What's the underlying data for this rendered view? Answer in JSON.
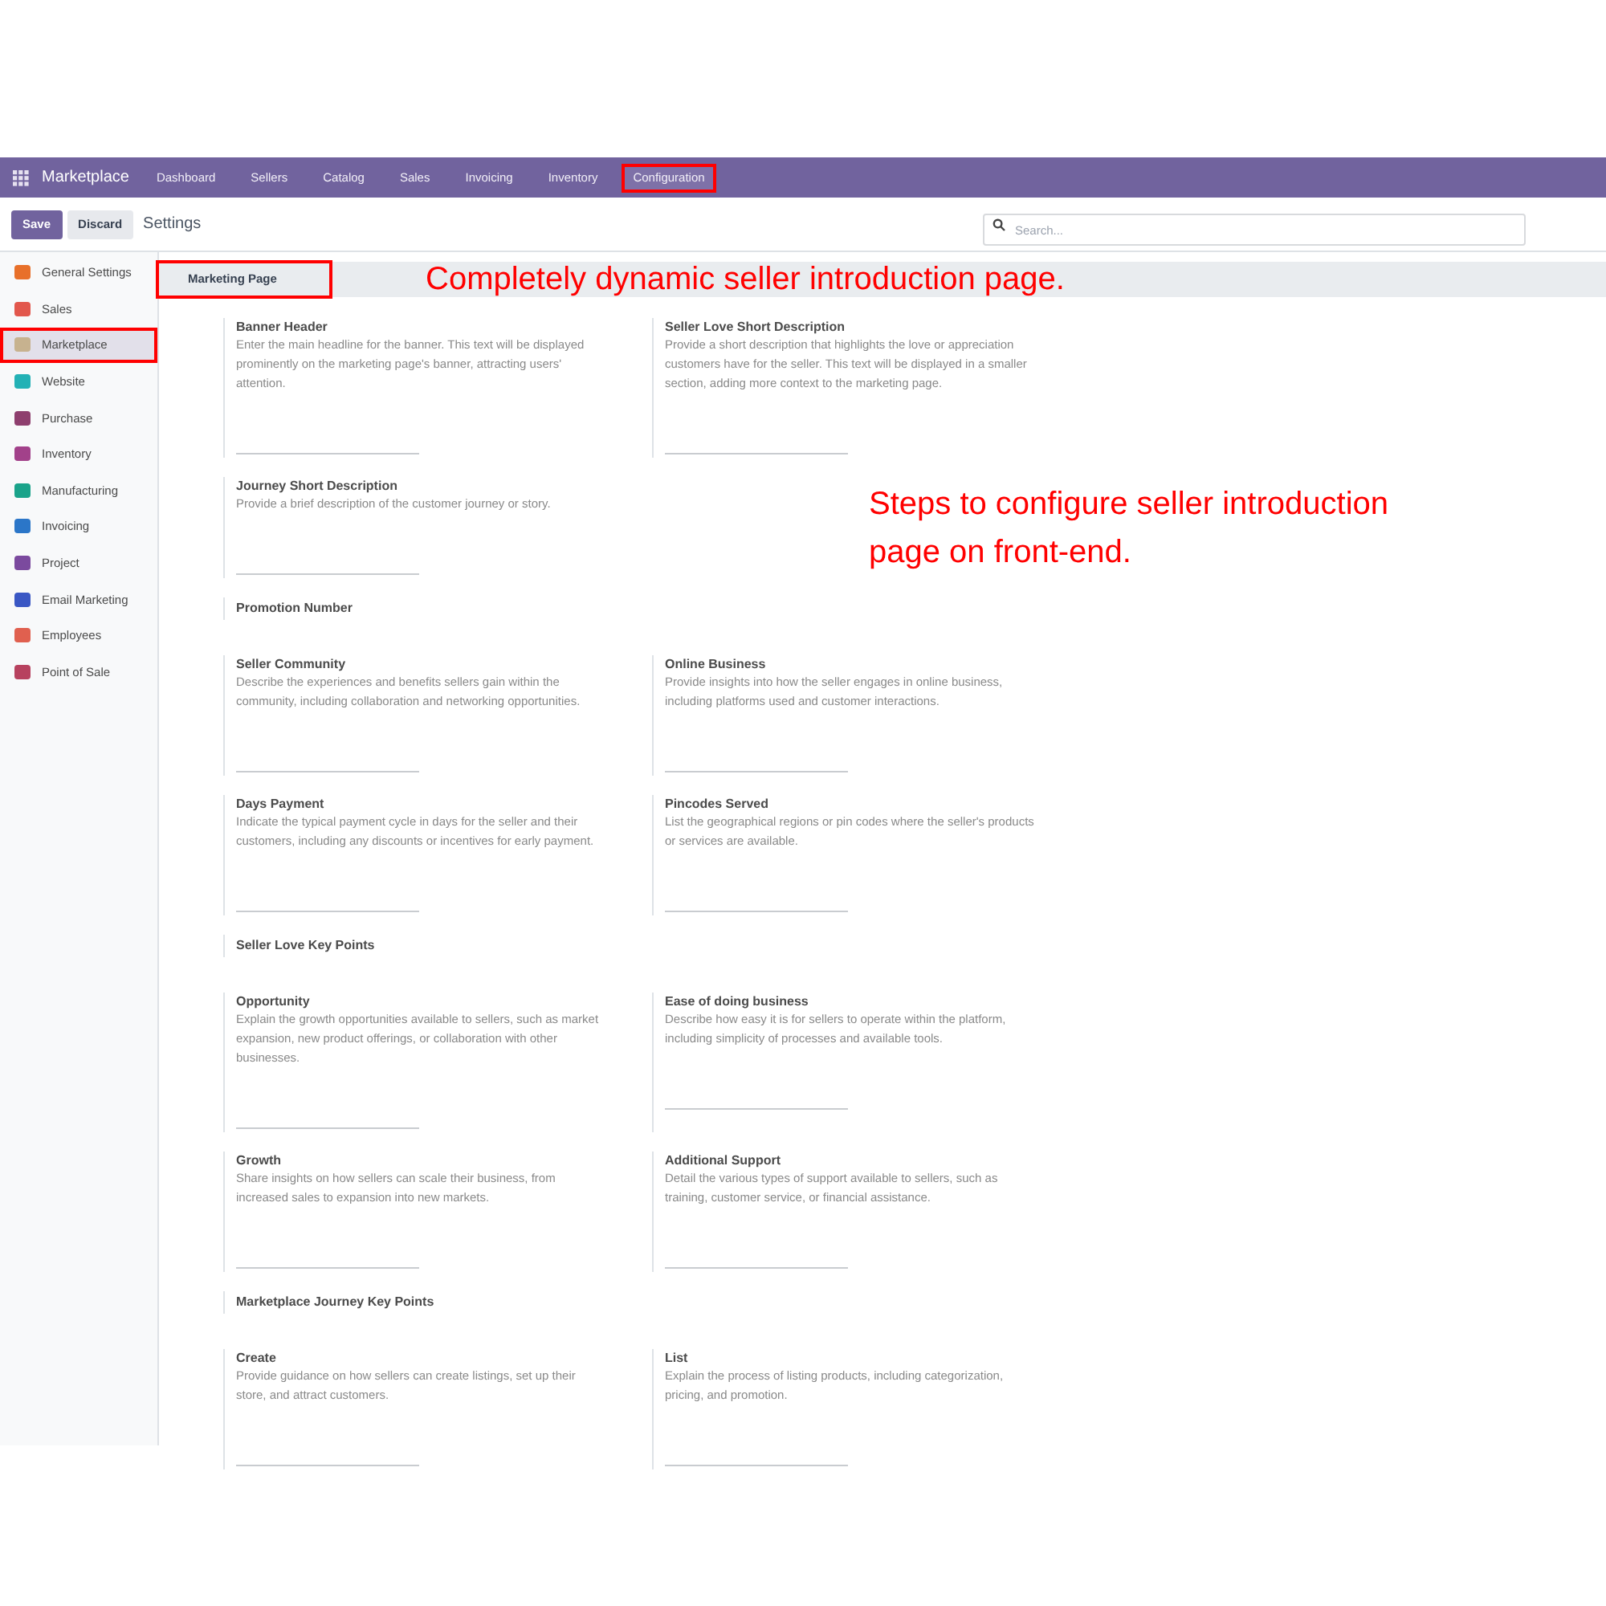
{
  "navbar": {
    "app": "Marketplace",
    "items": [
      {
        "label": "Dashboard",
        "highlighted": false
      },
      {
        "label": "Sellers",
        "highlighted": false
      },
      {
        "label": "Catalog",
        "highlighted": false
      },
      {
        "label": "Sales",
        "highlighted": false
      },
      {
        "label": "Invoicing",
        "highlighted": false
      },
      {
        "label": "Inventory",
        "highlighted": false
      },
      {
        "label": "Configuration",
        "highlighted": true
      }
    ]
  },
  "toolbar": {
    "buttons": [
      {
        "label": "Save",
        "kind": "primary"
      },
      {
        "label": "Discard",
        "kind": "secondary"
      }
    ],
    "breadcrumb": "Settings",
    "search": {
      "placeholder": "Search..."
    }
  },
  "sidebar": {
    "items": [
      {
        "label": "General Settings",
        "selected": false,
        "highlighted": false,
        "color": "#e8702a"
      },
      {
        "label": "Sales",
        "selected": false,
        "highlighted": false,
        "color": "#e2574c"
      },
      {
        "label": "Marketplace",
        "selected": true,
        "highlighted": true,
        "color": "#c7b28f"
      },
      {
        "label": "Website",
        "selected": false,
        "highlighted": false,
        "color": "#23b1b5"
      },
      {
        "label": "Purchase",
        "selected": false,
        "highlighted": false,
        "color": "#8e3f6e"
      },
      {
        "label": "Inventory",
        "selected": false,
        "highlighted": false,
        "color": "#a2418a"
      },
      {
        "label": "Manufacturing",
        "selected": false,
        "highlighted": false,
        "color": "#1aa38a"
      },
      {
        "label": "Invoicing",
        "selected": false,
        "highlighted": false,
        "color": "#2b76c8"
      },
      {
        "label": "Project",
        "selected": false,
        "highlighted": false,
        "color": "#7b4a9e"
      },
      {
        "label": "Email Marketing",
        "selected": false,
        "highlighted": false,
        "color": "#3a57c4"
      },
      {
        "label": "Employees",
        "selected": false,
        "highlighted": false,
        "color": "#e0604f"
      },
      {
        "label": "Point of Sale",
        "selected": false,
        "highlighted": false,
        "color": "#b7425f"
      }
    ]
  },
  "section": {
    "title": "Marketing Page",
    "highlighted": true,
    "annotation": "Completely dynamic seller introduction page."
  },
  "blocks": [
    {
      "kind": "pair",
      "settings": [
        {
          "title": "Banner Header",
          "description": "Enter the main headline for the banner. This text will be displayed prominently on the marketing page's banner, attracting users' attention."
        },
        {
          "title": "Seller Love Short Description",
          "description": "Provide a short description that highlights the love or appreciation customers have for the seller. This text will be displayed in a smaller section, adding more context to the marketing page."
        }
      ]
    },
    {
      "kind": "pair",
      "settings": [
        {
          "title": "Journey Short Description",
          "description": "Provide a brief description of the customer journey or story."
        }
      ],
      "annotation": "Steps to configure seller introduction page on front-end."
    },
    {
      "kind": "heading",
      "title": "Promotion Number"
    },
    {
      "kind": "pair",
      "settings": [
        {
          "title": "Seller Community",
          "description": "Describe the experiences and benefits sellers gain within the community, including collaboration and networking opportunities."
        },
        {
          "title": "Online Business",
          "description": "Provide insights into how the seller engages in online business, including platforms used and customer interactions."
        }
      ]
    },
    {
      "kind": "pair",
      "settings": [
        {
          "title": "Days Payment",
          "description": "Indicate the typical payment cycle in days for the seller and their customers, including any discounts or incentives for early payment."
        },
        {
          "title": "Pincodes Served",
          "description": "List the geographical regions or pin codes where the seller's products or services are available."
        }
      ]
    },
    {
      "kind": "heading",
      "title": "Seller Love Key Points"
    },
    {
      "kind": "pair",
      "settings": [
        {
          "title": "Opportunity",
          "description": "Explain the growth opportunities available to sellers, such as market expansion, new product offerings, or collaboration with other businesses."
        },
        {
          "title": "Ease of doing business",
          "description": "Describe how easy it is for sellers to operate within the platform, including simplicity of processes and available tools."
        }
      ]
    },
    {
      "kind": "pair",
      "settings": [
        {
          "title": "Growth",
          "description": "Share insights on how sellers can scale their business, from increased sales to expansion into new markets."
        },
        {
          "title": "Additional Support",
          "description": "Detail the various types of support available to sellers, such as training, customer service, or financial assistance."
        }
      ]
    },
    {
      "kind": "heading",
      "title": "Marketplace Journey Key Points"
    },
    {
      "kind": "pair",
      "settings": [
        {
          "title": "Create",
          "description": "Provide guidance on how sellers can create listings, set up their store, and attract customers."
        },
        {
          "title": "List",
          "description": "Explain the process of listing products, including categorization, pricing, and promotion."
        }
      ]
    }
  ]
}
